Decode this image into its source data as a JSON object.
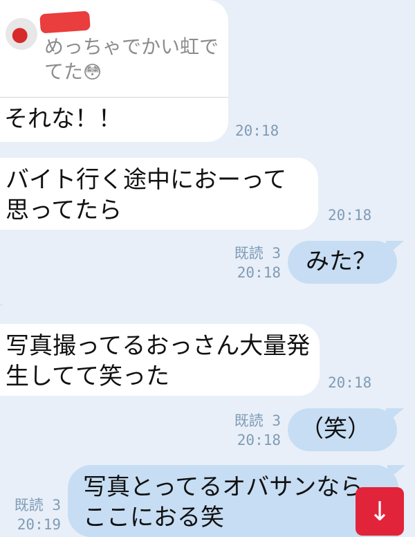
{
  "quoted": {
    "text": "めっちゃでかい虹でてた",
    "emoji": "😳"
  },
  "messages": [
    {
      "side": "left",
      "text": "それな！！",
      "time": "20:18"
    },
    {
      "side": "left",
      "text": "バイト行く途中におーって思ってたら",
      "time": "20:18"
    },
    {
      "side": "right",
      "text": "みた？",
      "read": "既読 3",
      "time": "20:18"
    },
    {
      "side": "left",
      "text": "写真撮ってるおっさん大量発生してて笑った",
      "time": "20:18"
    },
    {
      "side": "right",
      "text": "（笑）",
      "read": "既読 3",
      "time": "20:18"
    },
    {
      "side": "right",
      "text": "写真とってるオバサンならここにおる笑",
      "read": "既読 3",
      "time": "20:19"
    }
  ],
  "scroll_down_icon": "arrow-down-icon",
  "colors": {
    "background": "#e8eff8",
    "right_bubble": "#c6ddf3",
    "left_bubble": "#ffffff",
    "scroll_button": "#e2243a"
  }
}
